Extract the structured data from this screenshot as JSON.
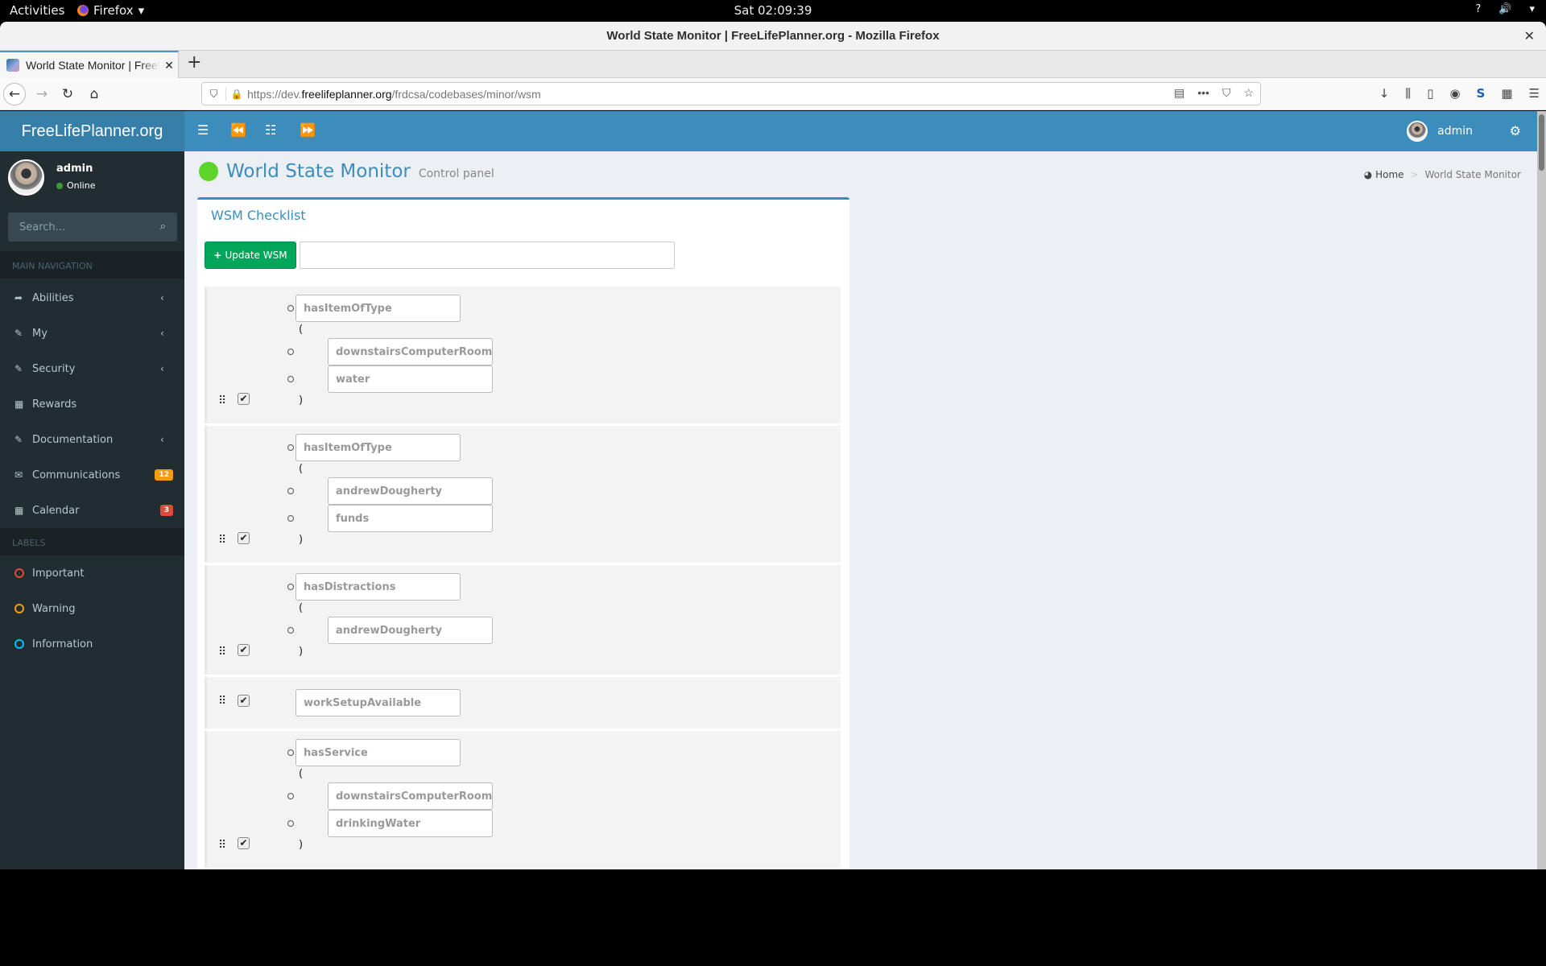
{
  "system": {
    "activities": "Activities",
    "app_menu": "Firefox",
    "clock": "Sat 02:09:39"
  },
  "window": {
    "title": "World State Monitor | FreeLifePlanner.org - Mozilla Firefox"
  },
  "browser": {
    "tab_title": "World State Monitor | FreeLifePlanner.org",
    "url_prefix": "https://dev.",
    "url_domain": "freelifeplanner.org",
    "url_path": "/frdcsa/codebases/minor/wsm"
  },
  "app": {
    "brand": "FreeLifePlanner.org",
    "brand_color": "#3c8dbc",
    "header_user": "admin",
    "user": {
      "name": "admin",
      "status": "Online"
    },
    "search_placeholder": "Search...",
    "nav_header": "MAIN NAVIGATION",
    "nav": [
      {
        "label": "Abilities",
        "icon": "share-icon",
        "chevron": true
      },
      {
        "label": "My",
        "icon": "edit-icon",
        "chevron": true
      },
      {
        "label": "Security",
        "icon": "edit-icon",
        "chevron": true
      },
      {
        "label": "Rewards",
        "icon": "calendar-icon",
        "chevron": false
      },
      {
        "label": "Documentation",
        "icon": "edit-icon",
        "chevron": true
      },
      {
        "label": "Communications",
        "icon": "envelope-icon",
        "badge": "12",
        "badge_color": "#f39c12"
      },
      {
        "label": "Calendar",
        "icon": "calendar-icon",
        "badge": "3",
        "badge_color": "#dd4b39"
      }
    ],
    "labels_header": "LABELS",
    "labels": [
      {
        "label": "Important",
        "color": "#dd4b39"
      },
      {
        "label": "Warning",
        "color": "#f39c12"
      },
      {
        "label": "Information",
        "color": "#00c0ef"
      }
    ]
  },
  "page": {
    "title": "World State Monitor",
    "subtitle": "Control panel",
    "status_color": "#5dd42a",
    "breadcrumb": [
      "Home",
      "World State Monitor"
    ],
    "box_title": "WSM Checklist",
    "update_button": "Update WSM",
    "update_input_value": "",
    "items": [
      {
        "predicate": "hasItemOfType",
        "args": [
          "downstairsComputerRoom",
          "water"
        ],
        "checked": true
      },
      {
        "predicate": "hasItemOfType",
        "args": [
          "andrewDougherty",
          "funds"
        ],
        "checked": true
      },
      {
        "predicate": "hasDistractions",
        "args": [
          "andrewDougherty"
        ],
        "checked": true
      },
      {
        "predicate": "workSetupAvailable",
        "args": [],
        "checked": true
      },
      {
        "predicate": "hasService",
        "args": [
          "downstairsComputerRoom",
          "drinkingWater"
        ],
        "checked": true
      }
    ],
    "open_paren": "(",
    "close_paren": ")"
  }
}
